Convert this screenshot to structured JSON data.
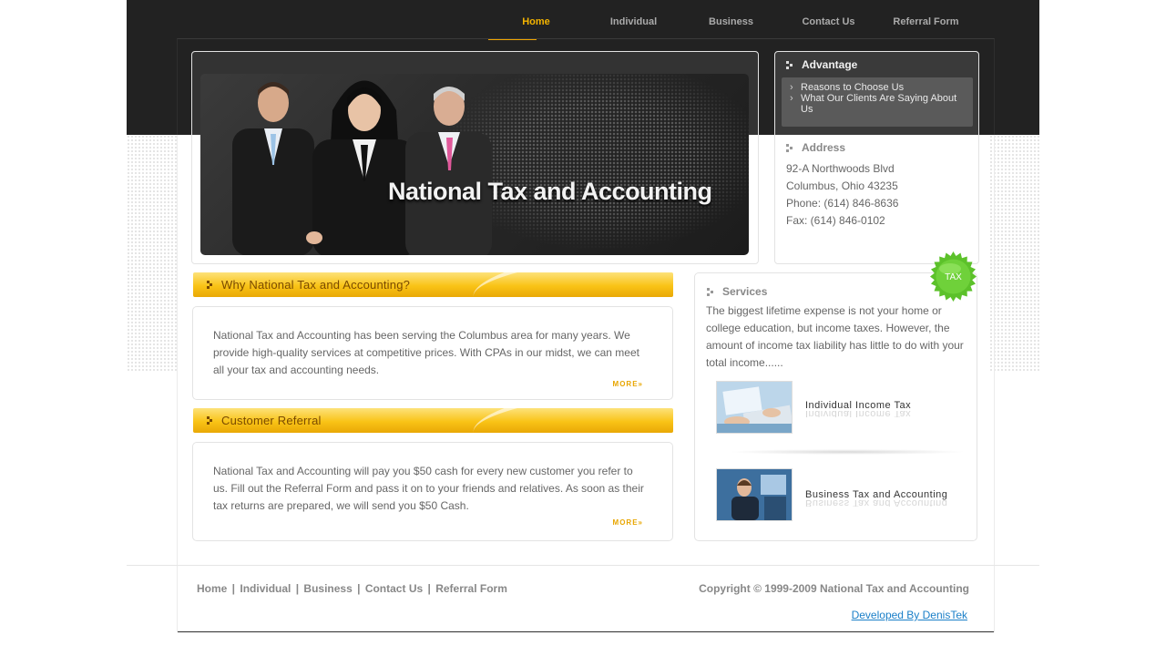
{
  "nav": {
    "items": [
      {
        "label": "Home",
        "active": true
      },
      {
        "label": "Individual",
        "active": false
      },
      {
        "label": "Business",
        "active": false
      },
      {
        "label": "Contact Us",
        "active": false
      },
      {
        "label": "Referral Form",
        "active": false
      }
    ]
  },
  "banner": {
    "title": "National Tax and Accounting"
  },
  "advantage": {
    "heading": "Advantage",
    "links": [
      "Reasons to Choose Us",
      "What Our Clients Are Saying About Us"
    ]
  },
  "address": {
    "heading": "Address",
    "lines": [
      "92-A Northwoods Blvd",
      "Columbus, Ohio 43235",
      "Phone: (614) 846-8636",
      "Fax: (614) 846-0102"
    ]
  },
  "why": {
    "heading": "Why National Tax and Accounting?",
    "text": "National Tax and Accounting has been serving the Columbus area for many years. We provide high-quality services at competitive prices. With CPAs in our midst, we can meet all your tax and accounting needs.",
    "more": "MORE»"
  },
  "referral": {
    "heading": "Customer Referral",
    "text": "National Tax and Accounting will pay you $50 cash for every new customer you refer to us. Fill out the Referral Form and pass it on to your friends and relatives. As soon as their tax returns are prepared, we will send you $50 Cash.",
    "more": "MORE»"
  },
  "services": {
    "heading": "Services",
    "badge": "TAX",
    "text": "The biggest lifetime expense is not your home or college education, but income taxes. However, the amount of income tax liability has little to do with your total income......",
    "items": [
      {
        "label": "Individual Income Tax"
      },
      {
        "label": "Business Tax and Accounting"
      }
    ]
  },
  "footer": {
    "links": [
      "Home",
      "Individual",
      "Business",
      "Contact Us",
      "Referral Form"
    ],
    "copyright": "Copyright © 1999-2009 National Tax and Accounting",
    "developer": "Developed By DenisTek"
  },
  "colors": {
    "accent": "#f4b400",
    "dark_band": "#222222",
    "link_blue": "#1a7fc8"
  }
}
